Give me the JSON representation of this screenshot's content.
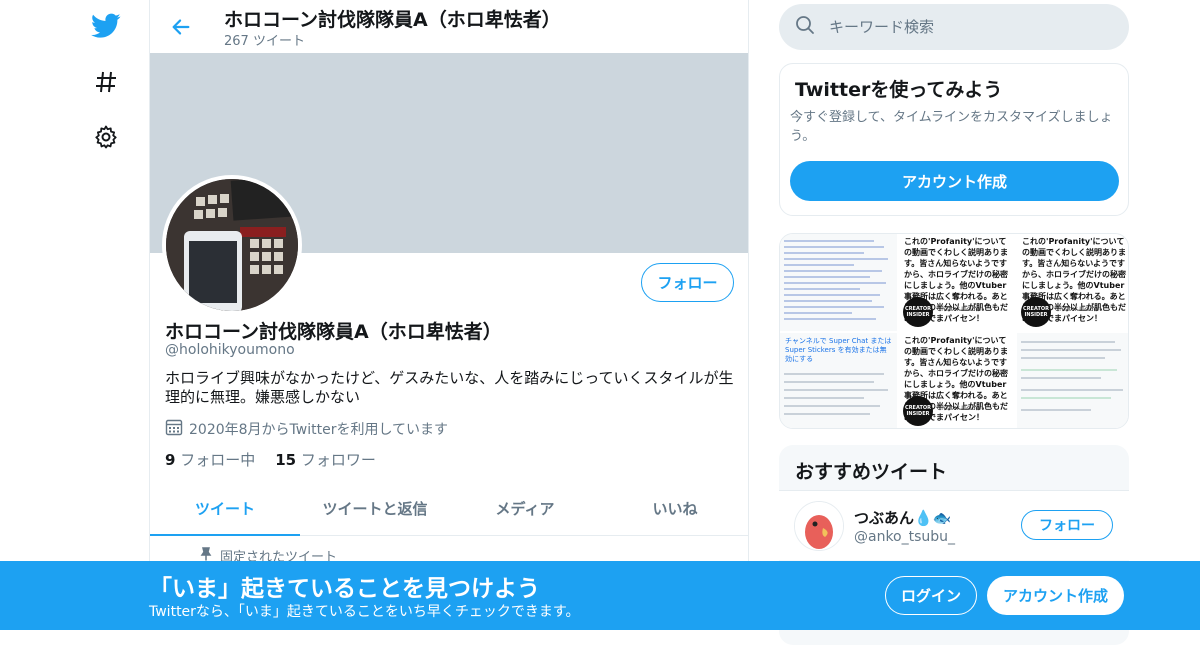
{
  "colors": {
    "accent": "#1da1f2",
    "banner": "#ccd6dd",
    "muted": "#657786"
  },
  "nav": {
    "icons": [
      "twitter-bird-icon",
      "hashtag-icon",
      "gear-icon"
    ]
  },
  "header": {
    "name": "ホロコーン討伐隊隊員A（ホロ卑怯者）",
    "tweet_count": "267 ツイート"
  },
  "profile": {
    "name": "ホロコーン討伐隊隊員A（ホロ卑怯者）",
    "handle": "@holohikyoumono",
    "bio": "ホロライブ興味がなかったけど、ゲスみたいな、人を踏みにじっていくスタイルが生理的に無理。嫌悪感しかない",
    "joined": "2020年8月からTwitterを利用しています",
    "following_count": "9",
    "following_label": "フォロー中",
    "followers_count": "15",
    "followers_label": "フォロワー",
    "follow_label": "フォロー"
  },
  "tabs": [
    {
      "label": "ツイート",
      "active": true
    },
    {
      "label": "ツイートと返信",
      "active": false
    },
    {
      "label": "メディア",
      "active": false
    },
    {
      "label": "いいね",
      "active": false
    }
  ],
  "pinned": {
    "label": "固定されたツイート"
  },
  "search": {
    "placeholder": "キーワード検索"
  },
  "signup_card": {
    "title": "Twitterを使ってみよう",
    "description": "今すぐ登録して、タイムラインをカスタマイズしましょう。",
    "button": "アカウント作成"
  },
  "media": {
    "caption": "これの'Profanity'についての動画でくわしく説明あります。皆さん知らないようですから、ホロライブだけの秘密にしましょう。他のVtuber事務所は広く奪われる。あとは動画の半分以上が肌色もだめなのでまパイセン！",
    "logo_text": "CREATOR INSIDER",
    "logo_name": "Creator Insider",
    "doc_heading": "チャンネルで Super Chat または Super Stickers を有効または無効にする"
  },
  "recommended": {
    "title": "おすすめツイート",
    "user_name": "つぶあん💧🐟",
    "user_handle": "@anko_tsubu_",
    "follow_label": "フォロー"
  },
  "bottom_bar": {
    "title": "「いま」起きていることを見つけよう",
    "subtitle": "Twitterなら、「いま」起きていることをいち早くチェックできます。",
    "login": "ログイン",
    "signup": "アカウント作成"
  }
}
